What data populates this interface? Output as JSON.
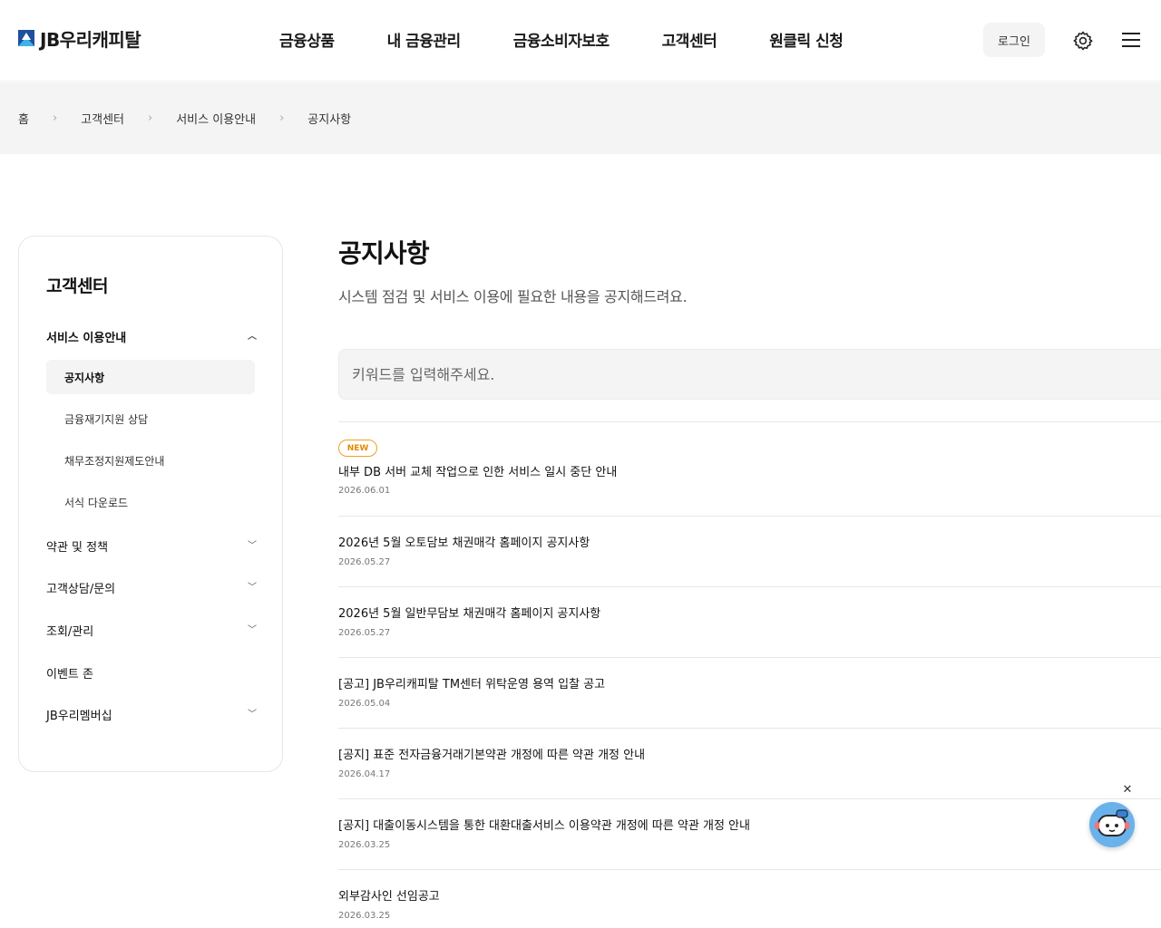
{
  "header": {
    "logo_text": "JB우리캐피탈",
    "nav": [
      "금융상품",
      "내 금융관리",
      "금융소비자보호",
      "고객센터",
      "원클릭 신청"
    ],
    "login_label": "로그인"
  },
  "breadcrumb": [
    "홈",
    "고객센터",
    "서비스 이용안내",
    "공지사항"
  ],
  "sidebar": {
    "title": "고객센터",
    "groups": [
      {
        "label": "서비스 이용안내",
        "expanded": true
      },
      {
        "label": "약관 및 정책",
        "expanded": false
      },
      {
        "label": "고객상담/문의",
        "expanded": false
      },
      {
        "label": "조회/관리",
        "expanded": false
      },
      {
        "label": "이벤트 존"
      },
      {
        "label": "JB우리멤버십",
        "expanded": false
      }
    ],
    "subitems": [
      "공지사항",
      "금융재기지원 상담",
      "채무조정지원제도안내",
      "서식 다운로드"
    ],
    "active_subitem": "공지사항"
  },
  "main": {
    "title": "공지사항",
    "description": "시스템 점검 및 서비스 이용에 필요한 내용을 공지해드려요.",
    "search_placeholder": "키워드를 입력해주세요.",
    "new_badge": "NEW",
    "notices": [
      {
        "title": "내부 DB 서버 교체 작업으로 인한 서비스 일시 중단 안내",
        "date": "2026.06.01",
        "is_new": true
      },
      {
        "title": "2026년 5월 오토담보 채권매각 홈페이지 공지사항",
        "date": "2026.05.27"
      },
      {
        "title": "2026년 5월 일반무담보 채권매각 홈페이지 공지사항",
        "date": "2026.05.27"
      },
      {
        "title": "[공고] JB우리캐피탈 TM센터 위탁운영 용역 입찰 공고",
        "date": "2026.05.04"
      },
      {
        "title": "[공지] 표준 전자금융거래기본약관 개정에 따른 약관 개정 안내",
        "date": "2026.04.17"
      },
      {
        "title": "[공지] 대출이동시스템을 통한 대환대출서비스 이용약관 개정에 따른 약관 개정 안내",
        "date": "2026.03.25"
      },
      {
        "title": "외부감사인 선임공고",
        "date": "2026.03.25"
      }
    ]
  },
  "colors": {
    "brand_blue": "#1f4fa0",
    "brand_light_blue": "#3fb3e6",
    "new_badge": "#f0a020",
    "gray_bg": "#f4f4f5"
  },
  "icons": {
    "settings": "gear-icon",
    "menu": "hamburger-icon",
    "chatbot": "chatbot-icon",
    "close": "close-icon"
  }
}
